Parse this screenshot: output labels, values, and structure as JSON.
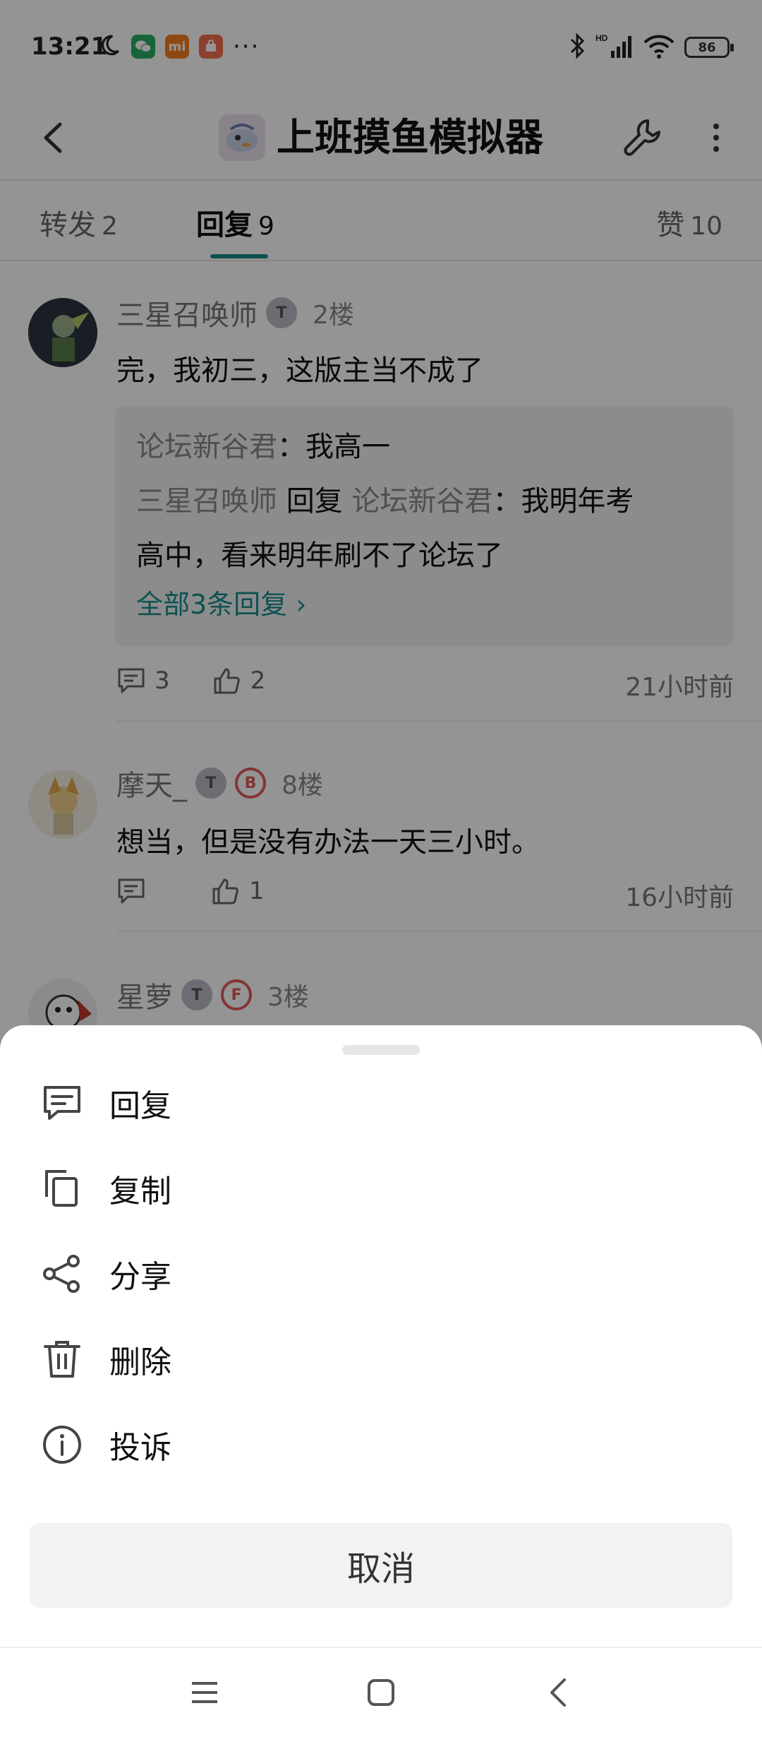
{
  "status_bar": {
    "time": "13:21",
    "notification_icons": [
      "moon-icon",
      "wechat-icon",
      "mi-icon",
      "mi-store-icon",
      "more-dots-icon"
    ],
    "battery": "86",
    "network": "HD"
  },
  "header": {
    "title": "上班摸鱼模拟器"
  },
  "tabs": [
    {
      "label": "转发",
      "count": "2"
    },
    {
      "label": "回复",
      "count": "9"
    },
    {
      "label": "赞",
      "count": "10"
    }
  ],
  "posts": [
    {
      "author": "三星召唤师",
      "floor": "2楼",
      "text": "完，我初三，这版主当不成了",
      "replies": {
        "line1_name": "论坛新谷君",
        "line1_text": "：我高一",
        "line2_name": "三星召唤师",
        "line2_mid": " 回复 ",
        "line2_target": "论坛新谷君",
        "line2_text": "：我明年考",
        "line3_text": "高中，看来明年刷不了论坛了",
        "more": "全部3条回复 ›"
      },
      "comments": "3",
      "likes": "2",
      "time": "21小时前"
    },
    {
      "author": "摩天_",
      "floor": "8楼",
      "text": "想当，但是没有办法一天三小时。",
      "comments": "",
      "likes": "1",
      "time": "16小时前"
    },
    {
      "author": "星萝",
      "floor": "3楼"
    }
  ],
  "sheet": {
    "items": [
      {
        "label": "回复",
        "icon": "comment-icon"
      },
      {
        "label": "复制",
        "icon": "copy-icon"
      },
      {
        "label": "分享",
        "icon": "share-icon"
      },
      {
        "label": "删除",
        "icon": "trash-icon"
      },
      {
        "label": "投诉",
        "icon": "info-icon"
      }
    ],
    "cancel": "取消"
  },
  "colors": {
    "accent": "#1a8c8c",
    "overlay": "rgba(0,0,0,0.42)"
  }
}
